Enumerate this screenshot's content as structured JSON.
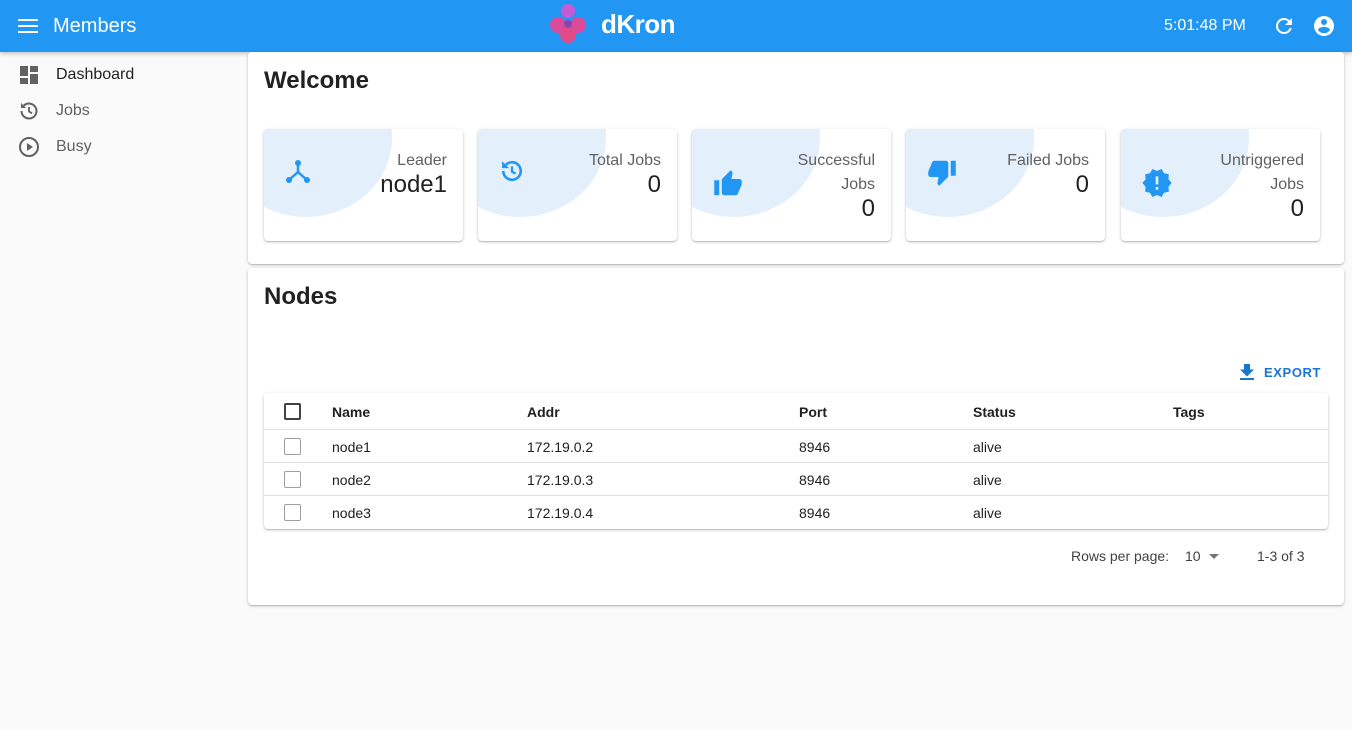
{
  "appbar": {
    "title": "Members",
    "logo_text": "dKron",
    "clock": "5:01:48 PM",
    "color": "#2196f3"
  },
  "sidebar": {
    "items": [
      {
        "label": "Dashboard",
        "icon": "dashboard-icon"
      },
      {
        "label": "Jobs",
        "icon": "history-icon"
      },
      {
        "label": "Busy",
        "icon": "play-circle-icon"
      }
    ]
  },
  "welcome": {
    "title": "Welcome",
    "cards": [
      {
        "label": "Leader",
        "value": "node1",
        "icon": "leader-icon"
      },
      {
        "label": "Total Jobs",
        "value": "0",
        "icon": "history-icon"
      },
      {
        "label": "Successful Jobs",
        "value": "0",
        "icon": "thumb-up-icon"
      },
      {
        "label": "Failed Jobs",
        "value": "0",
        "icon": "thumb-down-icon"
      },
      {
        "label": "Untriggered Jobs",
        "value": "0",
        "icon": "new-releases-icon"
      }
    ]
  },
  "nodes": {
    "title": "Nodes",
    "export_label": "EXPORT",
    "columns": [
      "Name",
      "Addr",
      "Port",
      "Status",
      "Tags"
    ],
    "rows": [
      {
        "name": "node1",
        "addr": "172.19.0.2",
        "port": "8946",
        "status": "alive",
        "tags": ""
      },
      {
        "name": "node2",
        "addr": "172.19.0.3",
        "port": "8946",
        "status": "alive",
        "tags": ""
      },
      {
        "name": "node3",
        "addr": "172.19.0.4",
        "port": "8946",
        "status": "alive",
        "tags": ""
      }
    ],
    "pagination": {
      "rows_per_page_label": "Rows per page:",
      "rows_per_page": "10",
      "range": "1-3 of 3"
    }
  },
  "colors": {
    "primary": "#2196f3",
    "card_accent": "#e3f0fc",
    "link": "#1976d2"
  }
}
